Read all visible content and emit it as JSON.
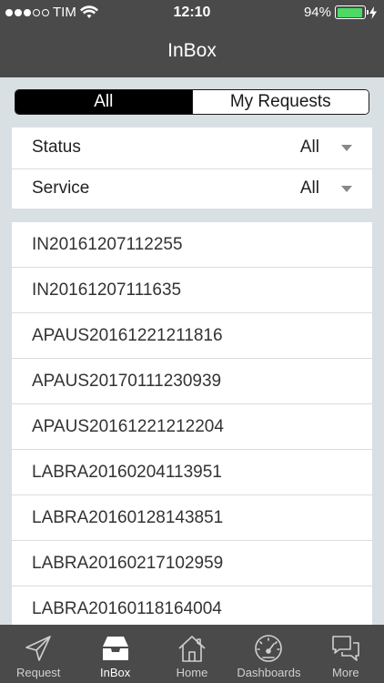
{
  "status_bar": {
    "carrier": "TIM",
    "time": "12:10",
    "battery": "94%",
    "battery_level": 0.94
  },
  "nav": {
    "title": "InBox"
  },
  "segments": [
    {
      "label": "All",
      "active": true
    },
    {
      "label": "My Requests",
      "active": false
    }
  ],
  "filters": [
    {
      "label": "Status",
      "value": "All"
    },
    {
      "label": "Service",
      "value": "All"
    }
  ],
  "items": [
    "IN20161207112255",
    "IN20161207111635",
    "APAUS20161221211816",
    "APAUS20170111230939",
    "APAUS20161221212204",
    "LABRA20160204113951",
    "LABRA20160128143851",
    "LABRA20160217102959",
    "LABRA20160118164004"
  ],
  "tabs": [
    {
      "label": "Request",
      "icon": "paper-plane-icon",
      "active": false
    },
    {
      "label": "InBox",
      "icon": "inbox-tray-icon",
      "active": true
    },
    {
      "label": "Home",
      "icon": "house-icon",
      "active": false
    },
    {
      "label": "Dashboards",
      "icon": "speedometer-icon",
      "active": false
    },
    {
      "label": "More",
      "icon": "chat-bubbles-icon",
      "active": false
    }
  ]
}
